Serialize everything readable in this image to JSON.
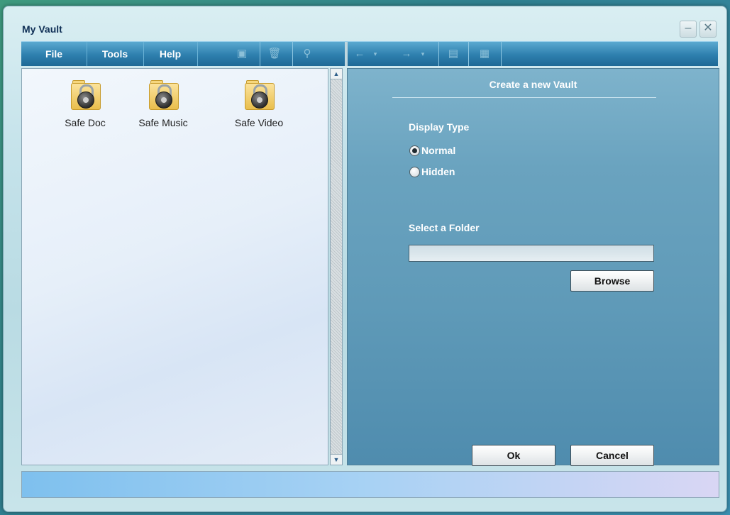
{
  "window": {
    "title": "My Vault"
  },
  "window_controls": {
    "minimize": "–",
    "close": "✕"
  },
  "menu": {
    "file": "File",
    "tools": "Tools",
    "help": "Help"
  },
  "toolbar_icons": [
    "save-icon",
    "trash-icon",
    "search-icon",
    "back-arrow-icon",
    "dropdown-icon",
    "forward-arrow-icon",
    "dropdown-icon",
    "folder-up-icon",
    "list-view-icon"
  ],
  "vaults": [
    {
      "label": "Safe Doc",
      "icon": "locked-folder-icon"
    },
    {
      "label": "Safe Music",
      "icon": "locked-folder-icon"
    },
    {
      "label": "Safe Video",
      "icon": "locked-folder-icon"
    }
  ],
  "create_panel": {
    "title": "Create a new Vault",
    "display_type_label": "Display Type",
    "options": [
      {
        "label": "Normal",
        "checked": true
      },
      {
        "label": "Hidden",
        "checked": false
      }
    ],
    "select_folder_label": "Select a Folder",
    "folder_value": "",
    "browse_label": "Browse",
    "ok_label": "Ok",
    "cancel_label": "Cancel"
  },
  "colors": {
    "toolbar": "#2e7fae",
    "panel": "#6aa3bf",
    "title_text": "#0f2f55"
  }
}
